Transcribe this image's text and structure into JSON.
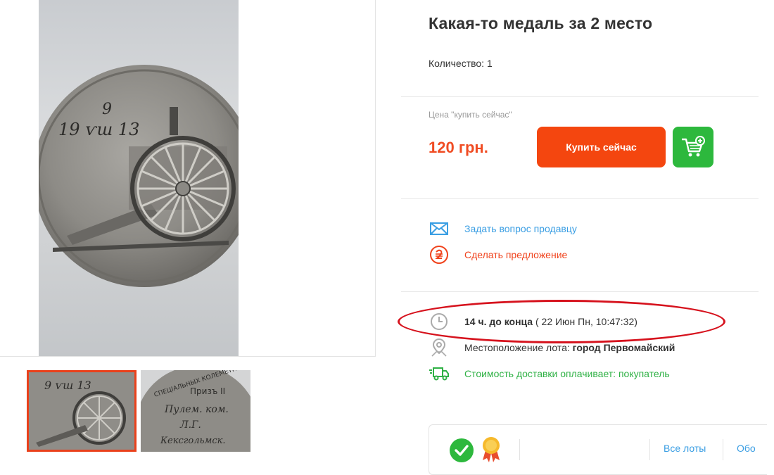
{
  "listing": {
    "title": "Какая-то медаль за 2 место",
    "quantity": "Количество: 1"
  },
  "price": {
    "caption": "Цена \"купить сейчас\"",
    "value": "120  грн."
  },
  "actions": {
    "buy_now_label": "Купить сейчас",
    "cart_icon": "cart-plus-icon"
  },
  "links": {
    "ask_seller": "Задать вопрос продавцу",
    "make_offer": "Сделать предложение"
  },
  "auction": {
    "time_left": "14 ч. до конца",
    "end_date": " ( 22 Июн Пн, 10:47:32)",
    "location_label": "Местоположение лота: ",
    "location_value": "город Первомайский",
    "delivery": "Стоимость доставки оплачивает: покупатель"
  },
  "seller": {
    "all_lots": "Все лоты",
    "reviews": "Обо"
  },
  "photo": {
    "medal_date_top": "9",
    "medal_date_line": "19 ѵш 13",
    "thumb1_text": "9 ѵш 13",
    "thumb2_lines": [
      "СПЕЦІАЛЬНЫХ КОЛЕМЕТНЫХ СТРЕЛ",
      "Призъ II",
      "Пулем. ком.",
      "Л.Г.",
      "Кексгольмск."
    ]
  },
  "colors": {
    "accent_red": "#f4460f",
    "price_red": "#f04c23",
    "link_blue": "#3a9ee3",
    "green": "#2db83d",
    "annotation_red": "#d6121d"
  }
}
